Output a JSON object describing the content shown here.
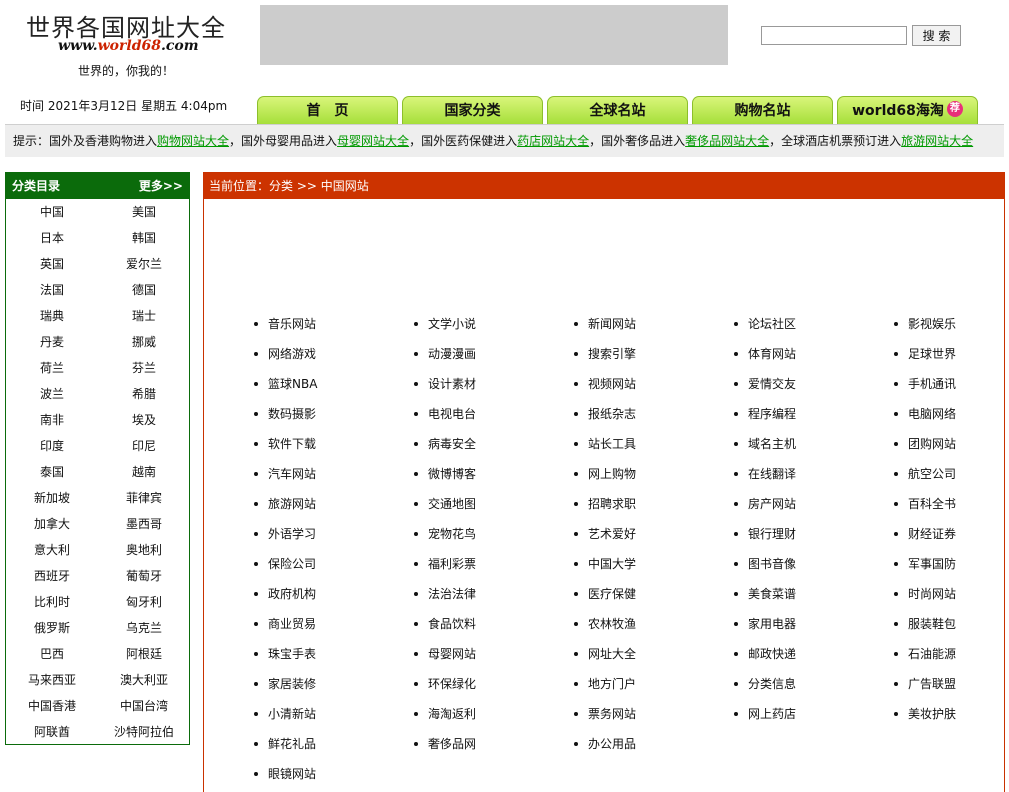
{
  "header": {
    "title": "世界各国网址大全",
    "url_prefix": "www.",
    "url_num": "world68",
    "url_suffix": ".com",
    "slogan": "世界的，你我的！",
    "search_button": "搜 索",
    "search_value": "",
    "datetime": "时间  2021年3月12日 星期五 4:04pm"
  },
  "nav": {
    "tabs": [
      "首　页",
      "国家分类",
      "全球名站",
      "购物名站",
      "world68海淘"
    ],
    "hot_badge": "荐"
  },
  "tips": {
    "parts": [
      {
        "text": "提示：国外及香港购物进入"
      },
      {
        "link": "购物网站大全"
      },
      {
        "text": "，国外母婴用品进入"
      },
      {
        "link": "母婴网站大全"
      },
      {
        "text": "，国外医药保健进入"
      },
      {
        "link": "药店网站大全"
      },
      {
        "text": "，国外奢侈品进入"
      },
      {
        "link": "奢侈品网站大全"
      },
      {
        "text": "，全球酒店机票预订进入"
      },
      {
        "link": "旅游网站大全"
      }
    ]
  },
  "sidebar": {
    "title": "分类目录",
    "more": "更多>>",
    "countries": [
      "中国",
      "美国",
      "日本",
      "韩国",
      "英国",
      "爱尔兰",
      "法国",
      "德国",
      "瑞典",
      "瑞士",
      "丹麦",
      "挪威",
      "荷兰",
      "芬兰",
      "波兰",
      "希腊",
      "南非",
      "埃及",
      "印度",
      "印尼",
      "泰国",
      "越南",
      "新加坡",
      "菲律宾",
      "加拿大",
      "墨西哥",
      "意大利",
      "奥地利",
      "西班牙",
      "葡萄牙",
      "比利时",
      "匈牙利",
      "俄罗斯",
      "乌克兰",
      "巴西",
      "阿根廷",
      "马来西亚",
      "澳大利亚",
      "中国香港",
      "中国台湾",
      "阿联酋",
      "沙特阿拉伯"
    ]
  },
  "main": {
    "breadcrumb": "当前位置：分类 >> 中国网站",
    "categories": [
      "音乐网站",
      "文学小说",
      "新闻网站",
      "论坛社区",
      "影视娱乐",
      "网络游戏",
      "动漫漫画",
      "搜索引擎",
      "体育网站",
      "足球世界",
      "篮球NBA",
      "设计素材",
      "视频网站",
      "爱情交友",
      "手机通讯",
      "数码摄影",
      "电视电台",
      "报纸杂志",
      "程序编程",
      "电脑网络",
      "软件下载",
      "病毒安全",
      "站长工具",
      "域名主机",
      "团购网站",
      "汽车网站",
      "微博博客",
      "网上购物",
      "在线翻译",
      "航空公司",
      "旅游网站",
      "交通地图",
      "招聘求职",
      "房产网站",
      "百科全书",
      "外语学习",
      "宠物花鸟",
      "艺术爱好",
      "银行理财",
      "财经证券",
      "保险公司",
      "福利彩票",
      "中国大学",
      "图书音像",
      "军事国防",
      "政府机构",
      "法治法律",
      "医疗保健",
      "美食菜谱",
      "时尚网站",
      "商业贸易",
      "食品饮料",
      "农林牧渔",
      "家用电器",
      "服装鞋包",
      "珠宝手表",
      "母婴网站",
      "网址大全",
      "邮政快递",
      "石油能源",
      "家居装修",
      "环保绿化",
      "地方门户",
      "分类信息",
      "广告联盟",
      "小清新站",
      "海淘返利",
      "票务网站",
      "网上药店",
      "美妆护肤",
      "鲜花礼品",
      "奢侈品网",
      "办公用品",
      "",
      "",
      "眼镜网站"
    ]
  }
}
